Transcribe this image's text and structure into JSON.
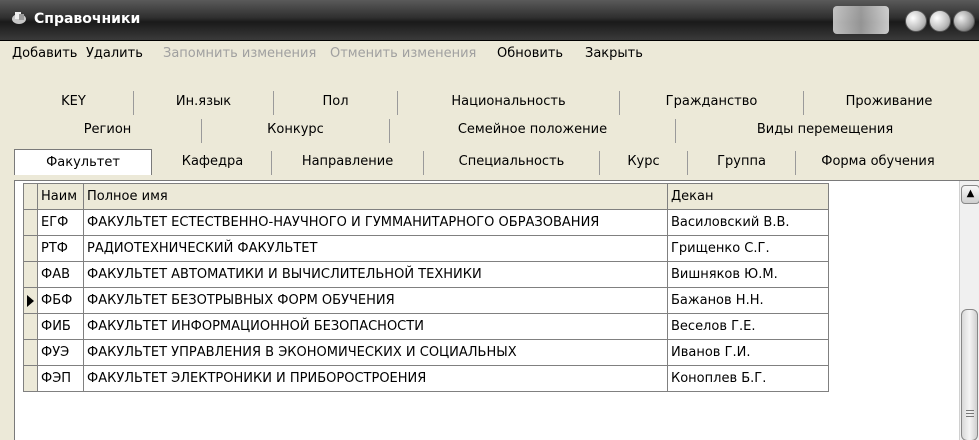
{
  "window": {
    "title": "Справочники"
  },
  "menu": {
    "items": [
      {
        "label": "Добавить",
        "enabled": true
      },
      {
        "label": "Удалить",
        "enabled": true
      },
      {
        "label": "Запомнить изменения",
        "enabled": false
      },
      {
        "label": "Отменить изменения",
        "enabled": false
      },
      {
        "label": "Обновить",
        "enabled": true
      },
      {
        "label": "Закрыть",
        "enabled": true
      }
    ]
  },
  "tabs": {
    "row1": [
      "KEY",
      "Ин.язык",
      "Пол",
      "Национальность",
      "Гражданство",
      "Проживание"
    ],
    "row2": [
      "Регион",
      "Конкурс",
      "Семейное положение",
      "Виды перемещения"
    ],
    "row3": [
      "Факультет",
      "Кафедра",
      "Направление",
      "Специальность",
      "Курс",
      "Группа",
      "Форма обучения"
    ],
    "selected": "Факультет"
  },
  "grid": {
    "headers": {
      "abbr": "Наим",
      "name": "Полное имя",
      "dean": "Декан"
    },
    "rows": [
      {
        "abbr": "ЕГФ",
        "name": "ФАКУЛЬТЕТ ЕСТЕСТВЕННО-НАУЧНОГО И ГУММАНИТАРНОГО ОБРАЗОВАНИЯ",
        "dean": "Василовский В.В.",
        "current": false
      },
      {
        "abbr": "РТФ",
        "name": "РАДИОТЕХНИЧЕСКИЙ ФАКУЛЬТЕТ",
        "dean": "Грищенко С.Г.",
        "current": false
      },
      {
        "abbr": "ФАВ",
        "name": "ФАКУЛЬТЕТ АВТОМАТИКИ И ВЫЧИСЛИТЕЛЬНОЙ ТЕХНИКИ",
        "dean": "Вишняков Ю.М.",
        "current": false
      },
      {
        "abbr": "ФБФ",
        "name": "ФАКУЛЬТЕТ БЕЗОТРЫВНЫХ ФОРМ ОБУЧЕНИЯ",
        "dean": "Бажанов Н.Н.",
        "current": true
      },
      {
        "abbr": "ФИБ",
        "name": "ФАКУЛЬТЕТ ИНФОРМАЦИОННОЙ БЕЗОПАСНОСТИ",
        "dean": "Веселов Г.Е.",
        "current": false
      },
      {
        "abbr": "ФУЭ",
        "name": "ФАКУЛЬТЕТ УПРАВЛЕНИЯ В ЭКОНОМИЧЕСКИХ И СОЦИАЛЬНЫХ",
        "dean": "Иванов Г.И.",
        "current": false
      },
      {
        "abbr": "ФЭП",
        "name": "ФАКУЛЬТЕТ ЭЛЕКТРОНИКИ И ПРИБОРОСТРОЕНИЯ",
        "dean": "Коноплев Б.Г.",
        "current": false
      }
    ]
  }
}
